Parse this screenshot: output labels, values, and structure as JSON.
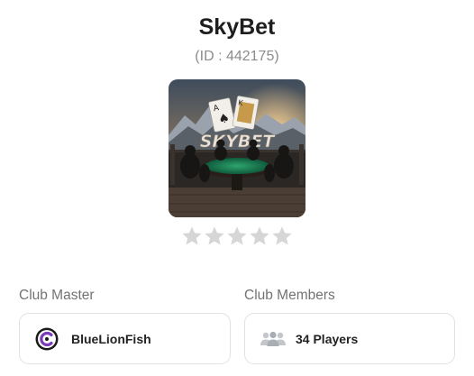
{
  "club": {
    "name": "SkyBet",
    "id_text": "(ID : 442175)",
    "image_logo_text": "SKYBET",
    "rating": {
      "value": 0,
      "max": 5
    }
  },
  "master": {
    "label": "Club Master",
    "name": "BlueLionFish",
    "avatar_icon": "c-logo-icon"
  },
  "members": {
    "label": "Club Members",
    "count_text": "34 Players",
    "icon": "people-group-icon"
  },
  "colors": {
    "star_empty": "#d6d6d6",
    "border": "#e1e1e1",
    "avatar_accent": "#7a3cb8"
  }
}
